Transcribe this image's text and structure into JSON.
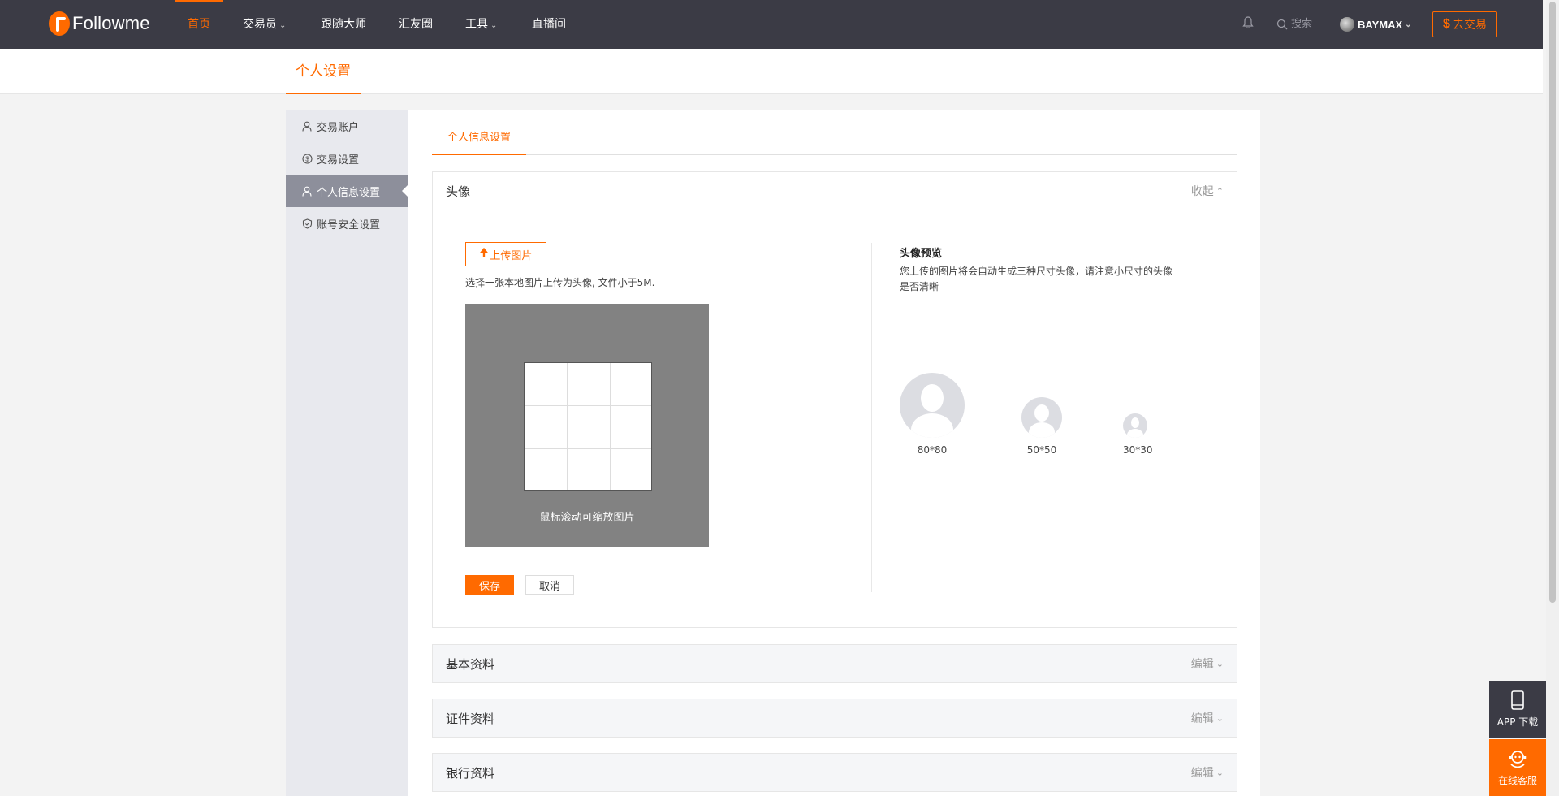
{
  "brand": {
    "name": "Followme",
    "accent": "#ff6a00"
  },
  "nav": {
    "items": [
      {
        "label": "首页",
        "active": true,
        "dropdown": false
      },
      {
        "label": "交易员",
        "active": false,
        "dropdown": true
      },
      {
        "label": "跟随大师",
        "active": false,
        "dropdown": false
      },
      {
        "label": "汇友圈",
        "active": false,
        "dropdown": false
      },
      {
        "label": "工具",
        "active": false,
        "dropdown": true
      },
      {
        "label": "直播间",
        "active": false,
        "dropdown": false
      }
    ],
    "search_label": "搜索",
    "username": "BAYMAX",
    "trade_button": "去交易",
    "trade_icon": "$"
  },
  "page": {
    "title": "个人设置"
  },
  "sidebar": {
    "items": [
      {
        "label": "交易账户",
        "icon": "user-icon",
        "active": false
      },
      {
        "label": "交易设置",
        "icon": "dollar-circle-icon",
        "active": false
      },
      {
        "label": "个人信息设置",
        "icon": "user-icon",
        "active": true
      },
      {
        "label": "账号安全设置",
        "icon": "shield-icon",
        "active": false
      }
    ]
  },
  "tabs": [
    {
      "label": "个人信息设置",
      "active": true
    }
  ],
  "avatar_panel": {
    "title": "头像",
    "toggle": "收起",
    "upload_button": "上传图片",
    "hint": "选择一张本地图片上传为头像, 文件小于5M.",
    "crop_tip": "鼠标滚动可缩放图片",
    "save": "保存",
    "cancel": "取消",
    "preview_title": "头像预览",
    "preview_desc": "您上传的图片将会自动生成三种尺寸头像，请注意小尺寸的头像是否清晰",
    "sizes": [
      "80*80",
      "50*50",
      "30*30"
    ]
  },
  "panels": [
    {
      "title": "基本资料",
      "action": "编辑"
    },
    {
      "title": "证件资料",
      "action": "编辑"
    },
    {
      "title": "银行资料",
      "action": "编辑"
    }
  ],
  "float": {
    "app": "APP 下载",
    "service": "在线客服"
  }
}
